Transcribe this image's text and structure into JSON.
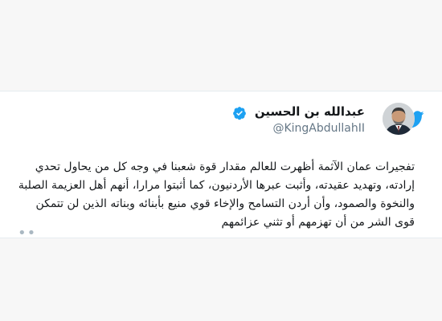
{
  "tweet": {
    "display_name": "عبدالله بن الحسين",
    "handle": "@KingAbdullahII",
    "text": "تفجيرات عمان الآثمة أظهرت للعالم مقدار قوة شعبنا في وجه كل من يحاول تحدي إرادته، وتهديد عقيدته، وأثبت عبرها الأردنيون، كما أثبتوا مرارا، أنهم أهل العزيمة الصلبة والنخوة والصمود، وأن أردن التسامح والإخاء قوي منيع بأبنائه وبناته الذين لن تتمكن قوى الشر من أن تهزمهم أو تثني عزائمهم",
    "more_indicator": "••"
  },
  "icons": {
    "brand": "twitter-bird-icon",
    "verified": "verified-badge-icon",
    "avatar": "avatar-photo"
  },
  "colors": {
    "twitter_blue": "#1da1f2",
    "verified_blue": "#1da1f2",
    "text": "#14171a",
    "handle": "#657786"
  }
}
